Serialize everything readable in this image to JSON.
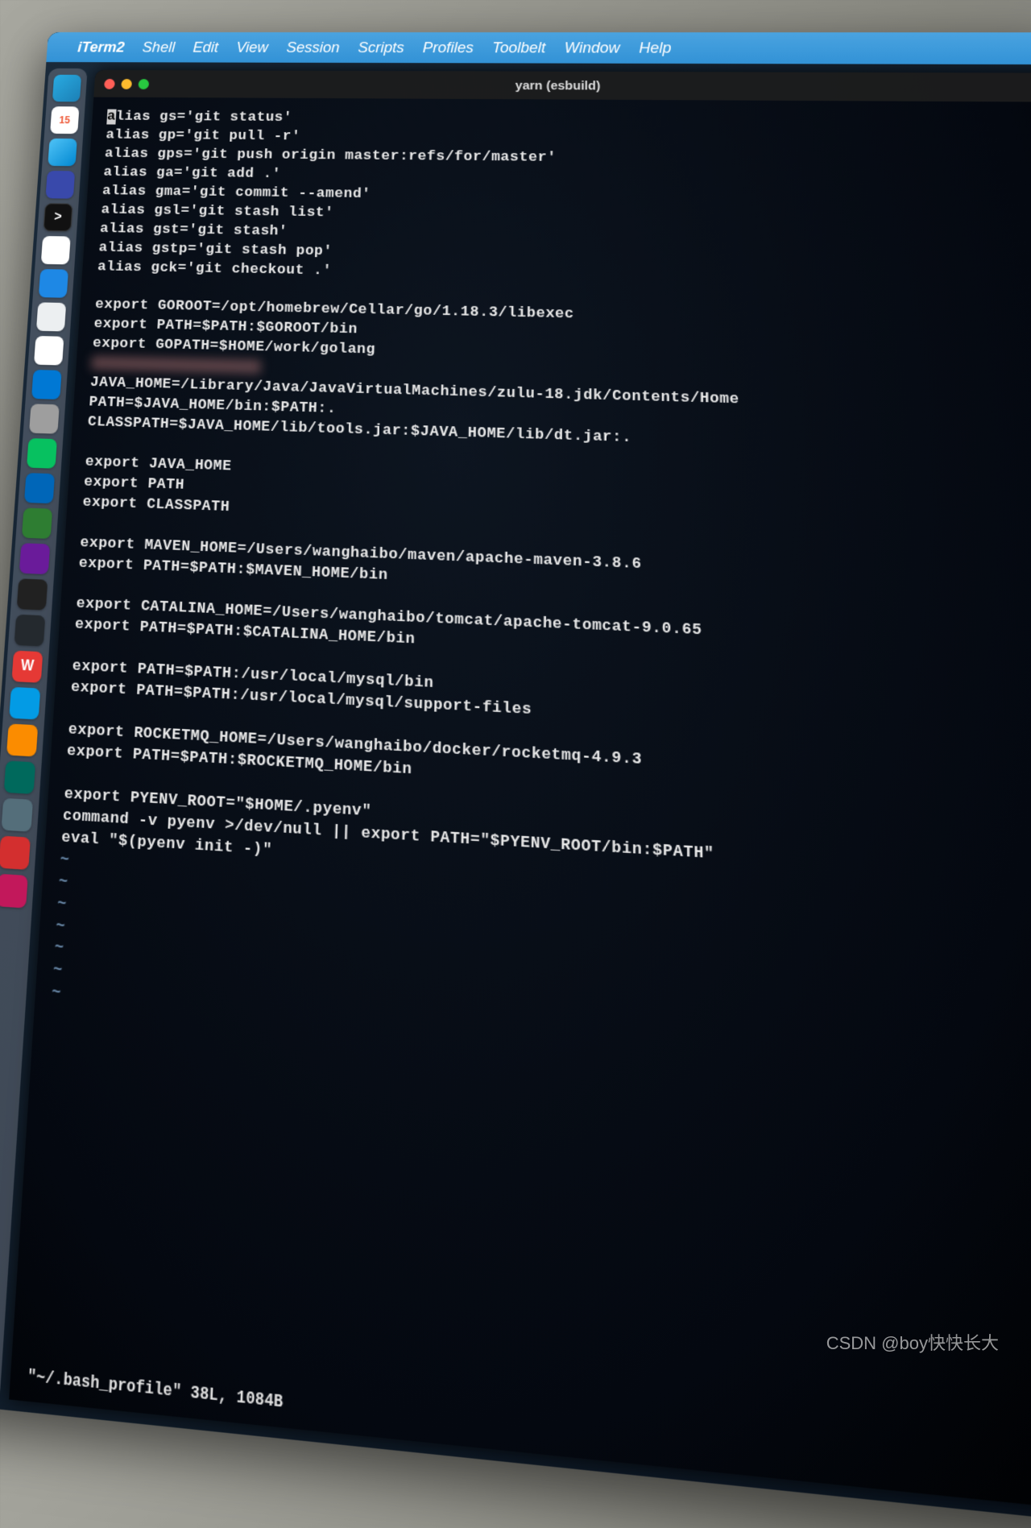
{
  "menubar": {
    "apple": "",
    "items": [
      "iTerm2",
      "Shell",
      "Edit",
      "View",
      "Session",
      "Scripts",
      "Profiles",
      "Toolbelt",
      "Window",
      "Help"
    ]
  },
  "dock": {
    "icons": [
      {
        "name": "finder-icon",
        "label": "",
        "cls": "di-finder"
      },
      {
        "name": "calendar-icon",
        "label": "15",
        "cls": "di-cal"
      },
      {
        "name": "weather-icon",
        "label": "",
        "cls": "di-weather"
      },
      {
        "name": "app-icon",
        "label": "",
        "cls": "di-blue"
      },
      {
        "name": "iterm-icon",
        "label": ">",
        "cls": "di-term"
      },
      {
        "name": "safari-icon",
        "label": "",
        "cls": "di-safari"
      },
      {
        "name": "mail-icon",
        "label": "",
        "cls": "di-mail"
      },
      {
        "name": "app-icon",
        "label": "",
        "cls": "di-white"
      },
      {
        "name": "chrome-icon",
        "label": "",
        "cls": "di-chrome"
      },
      {
        "name": "edge-icon",
        "label": "",
        "cls": "di-edge"
      },
      {
        "name": "settings-icon",
        "label": "",
        "cls": "di-settings"
      },
      {
        "name": "wechat-icon",
        "label": "",
        "cls": "di-wechat"
      },
      {
        "name": "vscode-icon",
        "label": "",
        "cls": "di-vscode"
      },
      {
        "name": "notes-icon",
        "label": "",
        "cls": "di-notes"
      },
      {
        "name": "app-icon",
        "label": "",
        "cls": "di-purple"
      },
      {
        "name": "app-icon",
        "label": "",
        "cls": "di-dark"
      },
      {
        "name": "github-icon",
        "label": "",
        "cls": "di-gh"
      },
      {
        "name": "wps-icon",
        "label": "W",
        "cls": "di-wps"
      },
      {
        "name": "map-icon",
        "label": "",
        "cls": "di-map"
      },
      {
        "name": "app-icon",
        "label": "",
        "cls": "di-orange"
      },
      {
        "name": "app-icon",
        "label": "",
        "cls": "di-teal"
      },
      {
        "name": "app-icon",
        "label": "",
        "cls": "di-gray"
      },
      {
        "name": "app-icon",
        "label": "",
        "cls": "di-red2"
      },
      {
        "name": "app-icon",
        "label": "",
        "cls": "di-red3"
      }
    ]
  },
  "terminal": {
    "title": "yarn (esbuild)",
    "cursor_char": "a",
    "lines": [
      "lias gs='git status'",
      "alias gp='git pull -r'",
      "alias gps='git push origin master:refs/for/master'",
      "alias ga='git add .'",
      "alias gma='git commit --amend'",
      "alias gsl='git stash list'",
      "alias gst='git stash'",
      "alias gstp='git stash pop'",
      "alias gck='git checkout .'",
      "",
      "export GOROOT=/opt/homebrew/Cellar/go/1.18.3/libexec",
      "export PATH=$PATH:$GOROOT/bin",
      "export GOPATH=$HOME/work/golang",
      "__REDACTED__",
      "JAVA_HOME=/Library/Java/JavaVirtualMachines/zulu-18.jdk/Contents/Home",
      "PATH=$JAVA_HOME/bin:$PATH:.",
      "CLASSPATH=$JAVA_HOME/lib/tools.jar:$JAVA_HOME/lib/dt.jar:.",
      "",
      "export JAVA_HOME",
      "export PATH",
      "export CLASSPATH",
      "",
      "export MAVEN_HOME=/Users/wanghaibo/maven/apache-maven-3.8.6",
      "export PATH=$PATH:$MAVEN_HOME/bin",
      "",
      "export CATALINA_HOME=/Users/wanghaibo/tomcat/apache-tomcat-9.0.65",
      "export PATH=$PATH:$CATALINA_HOME/bin",
      "",
      "export PATH=$PATH:/usr/local/mysql/bin",
      "export PATH=$PATH:/usr/local/mysql/support-files",
      "",
      "export ROCKETMQ_HOME=/Users/wanghaibo/docker/rocketmq-4.9.3",
      "export PATH=$PATH:$ROCKETMQ_HOME/bin",
      "",
      "export PYENV_ROOT=\"$HOME/.pyenv\"",
      "command -v pyenv >/dev/null || export PATH=\"$PYENV_ROOT/bin:$PATH\"",
      "eval \"$(pyenv init -)\"",
      "~",
      "~",
      "~",
      "~",
      "~",
      "~",
      "~"
    ],
    "statusline": "\"~/.bash_profile\" 38L, 1084B"
  },
  "watermark": "CSDN @boy快快长大"
}
